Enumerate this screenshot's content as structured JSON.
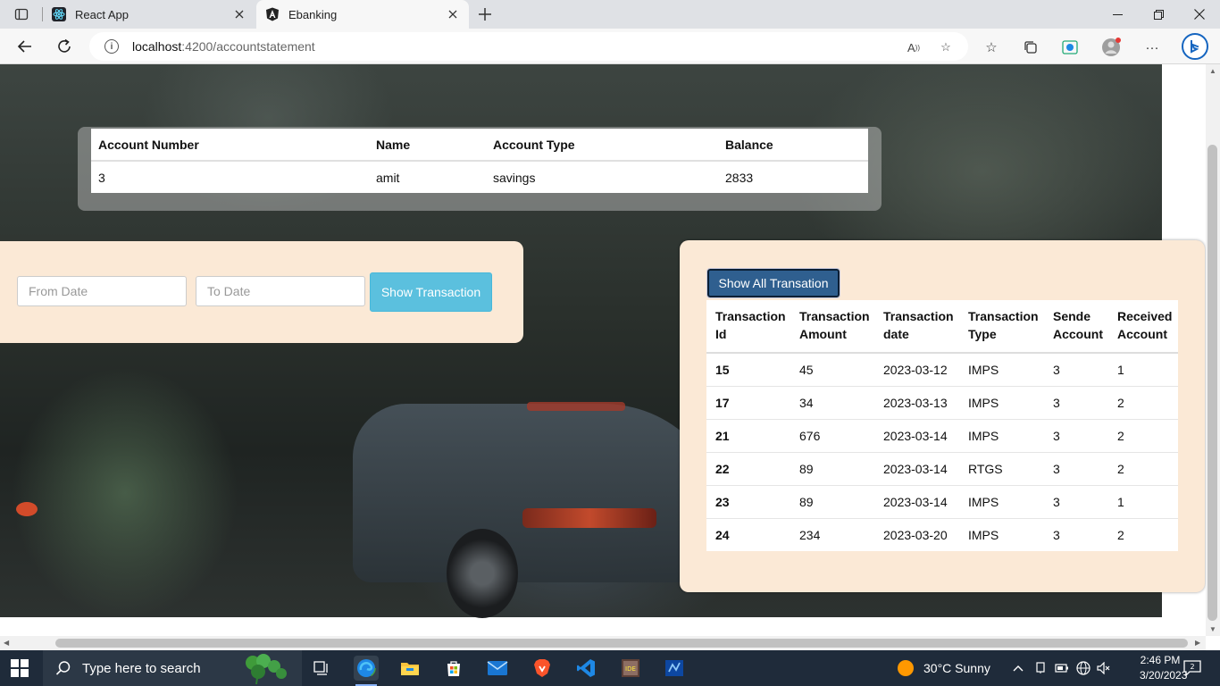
{
  "browser": {
    "tabs": [
      {
        "title": "React App",
        "icon": "react-icon",
        "active": false
      },
      {
        "title": "Ebanking",
        "icon": "angular-icon",
        "active": true
      }
    ],
    "url_host": "localhost",
    "url_path": ":4200/accountstatement"
  },
  "account": {
    "headers": [
      "Account Number",
      "Name",
      "Account Type",
      "Balance"
    ],
    "row": [
      "3",
      "amit",
      "savings",
      "2833"
    ]
  },
  "filter": {
    "from_placeholder": "From Date",
    "to_placeholder": "To Date",
    "show_label": "Show Transaction"
  },
  "transactions": {
    "show_all_label": "Show All Transation",
    "headers": [
      [
        "Transaction",
        "Id"
      ],
      [
        "Transaction",
        "Amount"
      ],
      [
        "Transaction",
        "date"
      ],
      [
        "Transaction",
        "Type"
      ],
      [
        "Sende",
        "Account"
      ],
      [
        "Received",
        "Account"
      ]
    ],
    "rows": [
      [
        "15",
        "45",
        "2023-03-12",
        "IMPS",
        "3",
        "1"
      ],
      [
        "17",
        "34",
        "2023-03-13",
        "IMPS",
        "3",
        "2"
      ],
      [
        "21",
        "676",
        "2023-03-14",
        "IMPS",
        "3",
        "2"
      ],
      [
        "22",
        "89",
        "2023-03-14",
        "RTGS",
        "3",
        "2"
      ],
      [
        "23",
        "89",
        "2023-03-14",
        "IMPS",
        "3",
        "1"
      ],
      [
        "24",
        "234",
        "2023-03-20",
        "IMPS",
        "3",
        "2"
      ]
    ]
  },
  "taskbar": {
    "search_placeholder": "Type here to search",
    "weather": "30°C  Sunny",
    "time": "2:46 PM",
    "date": "3/20/2023"
  },
  "colors": {
    "card_bg": "#fbe9d6",
    "info_button": "#5bc0de",
    "primary_button": "#2f5f8f"
  }
}
